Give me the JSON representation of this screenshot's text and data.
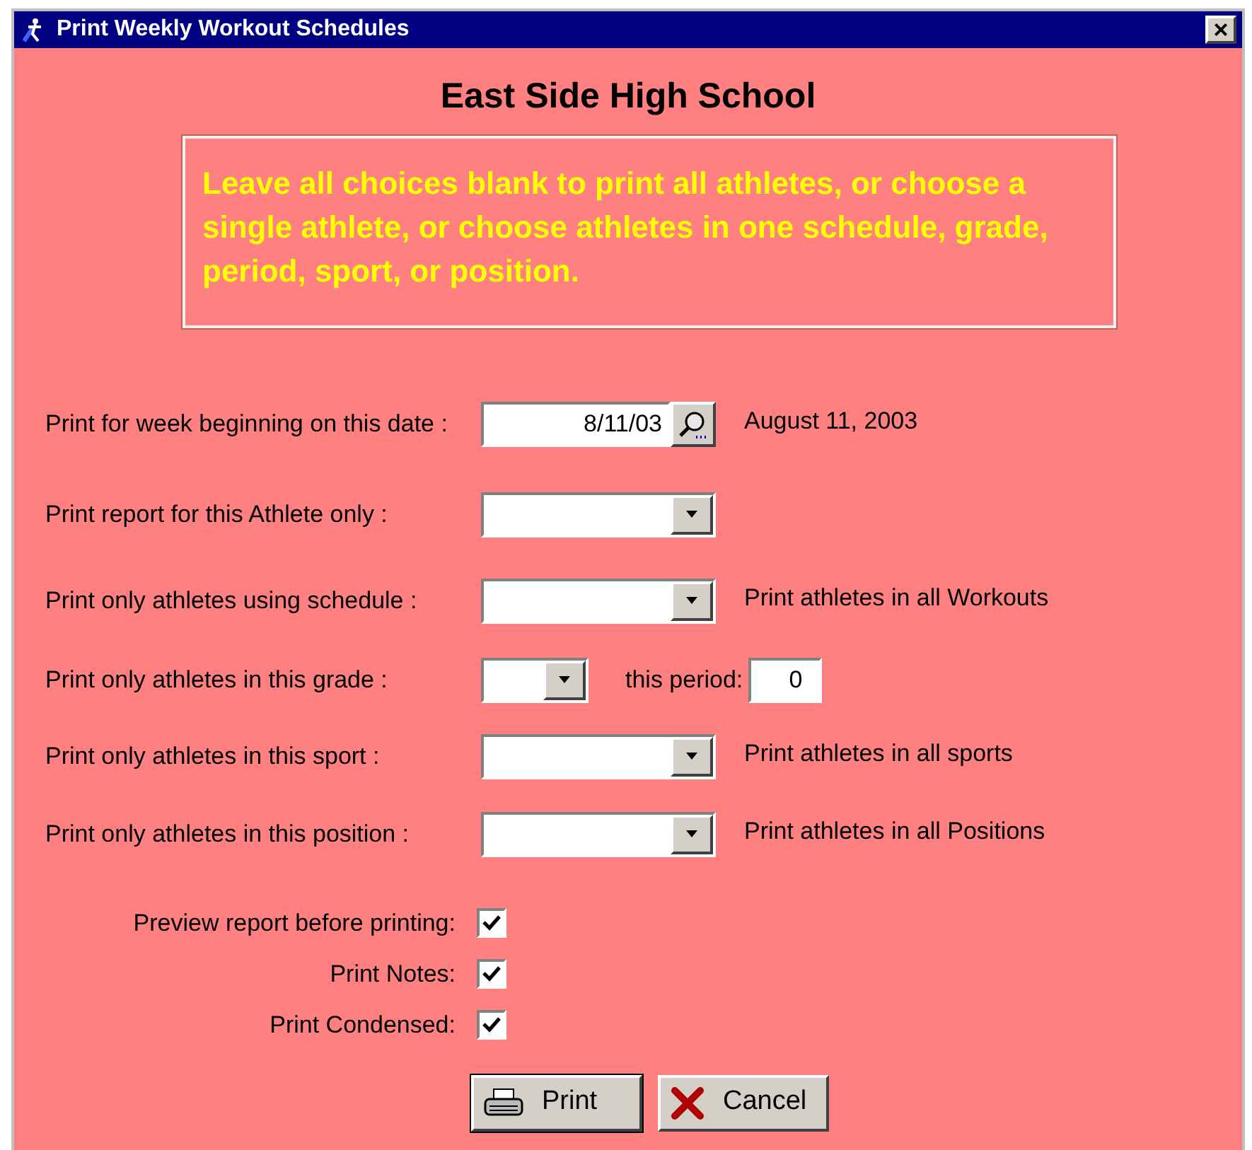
{
  "window": {
    "title": "Print Weekly Workout Schedules",
    "close": "×"
  },
  "heading": "East Side High School",
  "notice": "Leave all choices blank to print all athletes, or choose a single athlete, or choose athletes in one schedule, grade, period, sport, or position.",
  "rows": [
    {
      "kind": "date",
      "label": "Print for week beginning on this date :",
      "value": "8/11/03",
      "note": "August 11, 2003"
    },
    {
      "kind": "combo",
      "label": "Print report for this Athlete only :"
    },
    {
      "kind": "combo",
      "label": "Print only athletes using schedule :",
      "note": "Print athletes in all Workouts"
    },
    {
      "kind": "grade",
      "label": "Print only athletes in this grade :",
      "period_label": "this period:",
      "period_value": "0"
    },
    {
      "kind": "combo",
      "label": "Print only athletes in this sport :",
      "note": "Print athletes in all sports"
    },
    {
      "kind": "combo",
      "label": "Print only athletes in this position :",
      "note": "Print athletes in all Positions"
    }
  ],
  "options": [
    {
      "label": "Preview report before printing:",
      "checked": true
    },
    {
      "label": "Print Notes:",
      "checked": true
    },
    {
      "label": "Print Condensed:",
      "checked": true
    }
  ],
  "buttons": [
    {
      "kind": "print",
      "label": "Print"
    },
    {
      "kind": "cancel",
      "label": "Cancel"
    }
  ]
}
